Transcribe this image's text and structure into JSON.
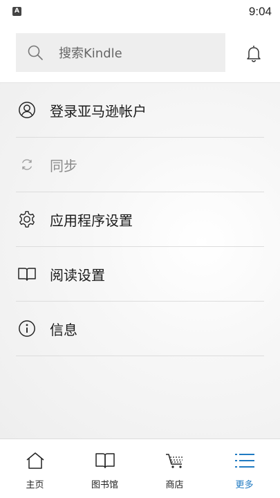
{
  "status_bar": {
    "time": "9:04",
    "app_icon_letter": "A"
  },
  "search": {
    "placeholder": "搜索Kindle"
  },
  "menu": {
    "items": [
      {
        "label": "登录亚马逊帐户",
        "icon": "account-icon",
        "enabled": true
      },
      {
        "label": "同步",
        "icon": "sync-icon",
        "enabled": false
      },
      {
        "label": "应用程序设置",
        "icon": "gear-icon",
        "enabled": true
      },
      {
        "label": "阅读设置",
        "icon": "book-icon",
        "enabled": true
      },
      {
        "label": "信息",
        "icon": "info-icon",
        "enabled": true
      }
    ]
  },
  "tabbar": {
    "tabs": [
      {
        "label": "主页",
        "icon": "home-icon"
      },
      {
        "label": "图书馆",
        "icon": "library-icon"
      },
      {
        "label": "商店",
        "icon": "cart-icon"
      },
      {
        "label": "更多",
        "icon": "menu-list-icon",
        "active": true
      }
    ]
  },
  "colors": {
    "accent": "#1f7ac2",
    "text": "#1a1a1a",
    "disabled": "#8a8a8a"
  }
}
